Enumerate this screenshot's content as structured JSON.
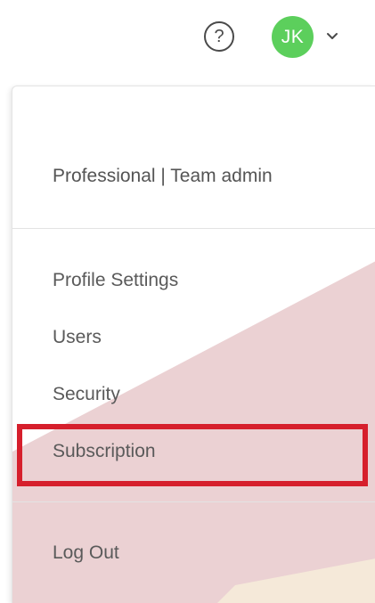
{
  "header": {
    "help_icon_glyph": "?",
    "avatar_initials": "JK",
    "avatar_color": "#5ccf5c"
  },
  "menu": {
    "account_label": "Professional | Team admin",
    "items": [
      {
        "label": "Profile Settings"
      },
      {
        "label": "Users"
      },
      {
        "label": "Security"
      },
      {
        "label": "Subscription"
      }
    ],
    "logout_label": "Log Out",
    "highlight_color": "#d61f2c"
  }
}
